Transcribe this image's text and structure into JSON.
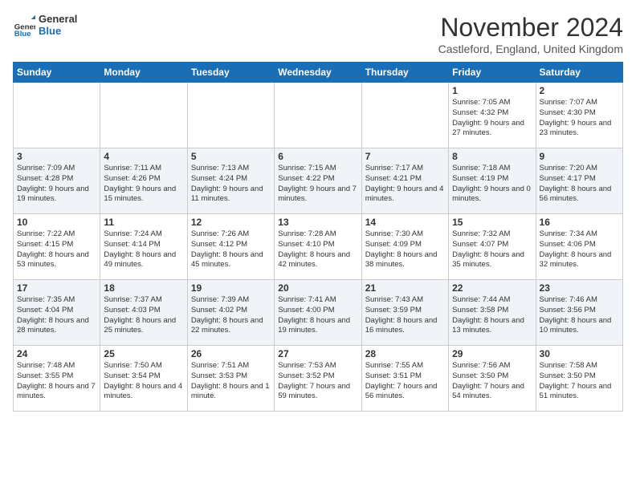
{
  "logo": {
    "general": "General",
    "blue": "Blue"
  },
  "header": {
    "title": "November 2024",
    "location": "Castleford, England, United Kingdom"
  },
  "weekdays": [
    "Sunday",
    "Monday",
    "Tuesday",
    "Wednesday",
    "Thursday",
    "Friday",
    "Saturday"
  ],
  "weeks": [
    [
      {
        "day": "",
        "info": ""
      },
      {
        "day": "",
        "info": ""
      },
      {
        "day": "",
        "info": ""
      },
      {
        "day": "",
        "info": ""
      },
      {
        "day": "",
        "info": ""
      },
      {
        "day": "1",
        "info": "Sunrise: 7:05 AM\nSunset: 4:32 PM\nDaylight: 9 hours and 27 minutes."
      },
      {
        "day": "2",
        "info": "Sunrise: 7:07 AM\nSunset: 4:30 PM\nDaylight: 9 hours and 23 minutes."
      }
    ],
    [
      {
        "day": "3",
        "info": "Sunrise: 7:09 AM\nSunset: 4:28 PM\nDaylight: 9 hours and 19 minutes."
      },
      {
        "day": "4",
        "info": "Sunrise: 7:11 AM\nSunset: 4:26 PM\nDaylight: 9 hours and 15 minutes."
      },
      {
        "day": "5",
        "info": "Sunrise: 7:13 AM\nSunset: 4:24 PM\nDaylight: 9 hours and 11 minutes."
      },
      {
        "day": "6",
        "info": "Sunrise: 7:15 AM\nSunset: 4:22 PM\nDaylight: 9 hours and 7 minutes."
      },
      {
        "day": "7",
        "info": "Sunrise: 7:17 AM\nSunset: 4:21 PM\nDaylight: 9 hours and 4 minutes."
      },
      {
        "day": "8",
        "info": "Sunrise: 7:18 AM\nSunset: 4:19 PM\nDaylight: 9 hours and 0 minutes."
      },
      {
        "day": "9",
        "info": "Sunrise: 7:20 AM\nSunset: 4:17 PM\nDaylight: 8 hours and 56 minutes."
      }
    ],
    [
      {
        "day": "10",
        "info": "Sunrise: 7:22 AM\nSunset: 4:15 PM\nDaylight: 8 hours and 53 minutes."
      },
      {
        "day": "11",
        "info": "Sunrise: 7:24 AM\nSunset: 4:14 PM\nDaylight: 8 hours and 49 minutes."
      },
      {
        "day": "12",
        "info": "Sunrise: 7:26 AM\nSunset: 4:12 PM\nDaylight: 8 hours and 45 minutes."
      },
      {
        "day": "13",
        "info": "Sunrise: 7:28 AM\nSunset: 4:10 PM\nDaylight: 8 hours and 42 minutes."
      },
      {
        "day": "14",
        "info": "Sunrise: 7:30 AM\nSunset: 4:09 PM\nDaylight: 8 hours and 38 minutes."
      },
      {
        "day": "15",
        "info": "Sunrise: 7:32 AM\nSunset: 4:07 PM\nDaylight: 8 hours and 35 minutes."
      },
      {
        "day": "16",
        "info": "Sunrise: 7:34 AM\nSunset: 4:06 PM\nDaylight: 8 hours and 32 minutes."
      }
    ],
    [
      {
        "day": "17",
        "info": "Sunrise: 7:35 AM\nSunset: 4:04 PM\nDaylight: 8 hours and 28 minutes."
      },
      {
        "day": "18",
        "info": "Sunrise: 7:37 AM\nSunset: 4:03 PM\nDaylight: 8 hours and 25 minutes."
      },
      {
        "day": "19",
        "info": "Sunrise: 7:39 AM\nSunset: 4:02 PM\nDaylight: 8 hours and 22 minutes."
      },
      {
        "day": "20",
        "info": "Sunrise: 7:41 AM\nSunset: 4:00 PM\nDaylight: 8 hours and 19 minutes."
      },
      {
        "day": "21",
        "info": "Sunrise: 7:43 AM\nSunset: 3:59 PM\nDaylight: 8 hours and 16 minutes."
      },
      {
        "day": "22",
        "info": "Sunrise: 7:44 AM\nSunset: 3:58 PM\nDaylight: 8 hours and 13 minutes."
      },
      {
        "day": "23",
        "info": "Sunrise: 7:46 AM\nSunset: 3:56 PM\nDaylight: 8 hours and 10 minutes."
      }
    ],
    [
      {
        "day": "24",
        "info": "Sunrise: 7:48 AM\nSunset: 3:55 PM\nDaylight: 8 hours and 7 minutes."
      },
      {
        "day": "25",
        "info": "Sunrise: 7:50 AM\nSunset: 3:54 PM\nDaylight: 8 hours and 4 minutes."
      },
      {
        "day": "26",
        "info": "Sunrise: 7:51 AM\nSunset: 3:53 PM\nDaylight: 8 hours and 1 minute."
      },
      {
        "day": "27",
        "info": "Sunrise: 7:53 AM\nSunset: 3:52 PM\nDaylight: 7 hours and 59 minutes."
      },
      {
        "day": "28",
        "info": "Sunrise: 7:55 AM\nSunset: 3:51 PM\nDaylight: 7 hours and 56 minutes."
      },
      {
        "day": "29",
        "info": "Sunrise: 7:56 AM\nSunset: 3:50 PM\nDaylight: 7 hours and 54 minutes."
      },
      {
        "day": "30",
        "info": "Sunrise: 7:58 AM\nSunset: 3:50 PM\nDaylight: 7 hours and 51 minutes."
      }
    ]
  ]
}
